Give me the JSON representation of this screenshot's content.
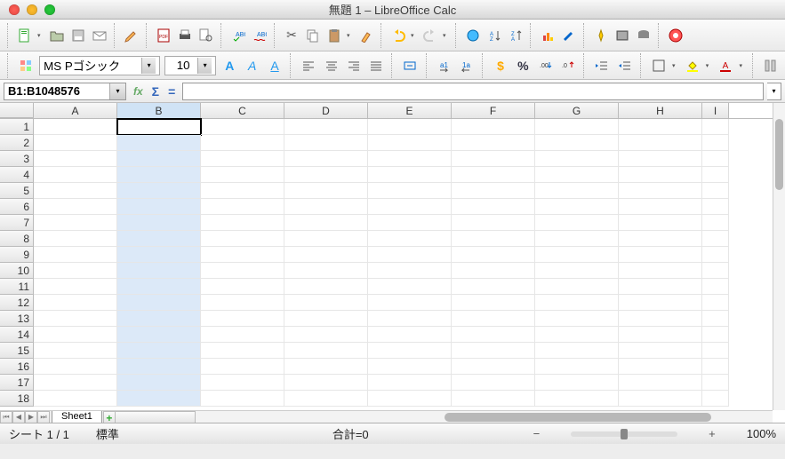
{
  "window": {
    "title": "無題 1 – LibreOffice Calc"
  },
  "toolbar": {
    "font_name": "MS Pゴシック",
    "font_size": "10",
    "bold": "A",
    "italic": "A",
    "underline": "A"
  },
  "formulabar": {
    "cellref": "B1:B1048576",
    "formula": ""
  },
  "columns": [
    "A",
    "B",
    "C",
    "D",
    "E",
    "F",
    "G",
    "H",
    "I"
  ],
  "rows": [
    "1",
    "2",
    "3",
    "4",
    "5",
    "6",
    "7",
    "8",
    "9",
    "10",
    "11",
    "12",
    "13",
    "14",
    "15",
    "16",
    "17",
    "18"
  ],
  "selected_column_index": 1,
  "active_row_index": 0,
  "tabs": {
    "sheet1": "Sheet1"
  },
  "statusbar": {
    "sheetpos": "シート 1 / 1",
    "style": "標準",
    "sum": "合計=0",
    "zoom": "100%"
  },
  "icons": {
    "plus": "+",
    "minus": "−"
  }
}
